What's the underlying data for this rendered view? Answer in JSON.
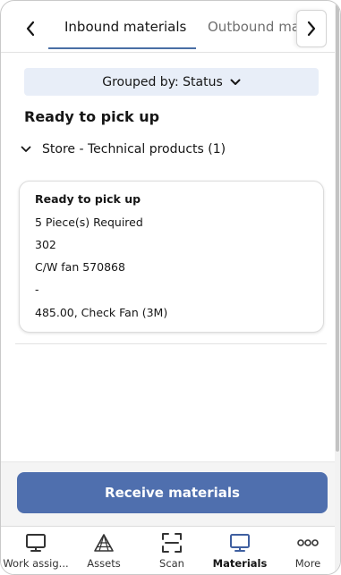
{
  "tabs": {
    "items": [
      {
        "label": "Inbound materials",
        "active": true
      },
      {
        "label": "Outbound materials",
        "active": false
      }
    ]
  },
  "group_by": {
    "label": "Grouped by: Status"
  },
  "section": {
    "title": "Ready to pick up"
  },
  "group": {
    "label": "Store - Technical products (1)"
  },
  "card": {
    "status": "Ready to pick up",
    "quantity": "5 Piece(s) Required",
    "code": "302",
    "description": "C/W fan 570868",
    "separator": "-",
    "detail": "485.00, Check Fan (3M)"
  },
  "actions": {
    "receive_label": "Receive materials"
  },
  "bottom_nav": {
    "items": [
      {
        "label": "Work assig...",
        "icon": "monitor-icon"
      },
      {
        "label": "Assets",
        "icon": "assets-icon"
      },
      {
        "label": "Scan",
        "icon": "scan-icon"
      },
      {
        "label": "Materials",
        "icon": "monitor-icon",
        "active": true
      },
      {
        "label": "More",
        "icon": "more-icon"
      }
    ]
  },
  "colors": {
    "accent": "#4f6fae",
    "groupby_bg": "#e8eef8",
    "active_icon": "#3f5fa0"
  }
}
